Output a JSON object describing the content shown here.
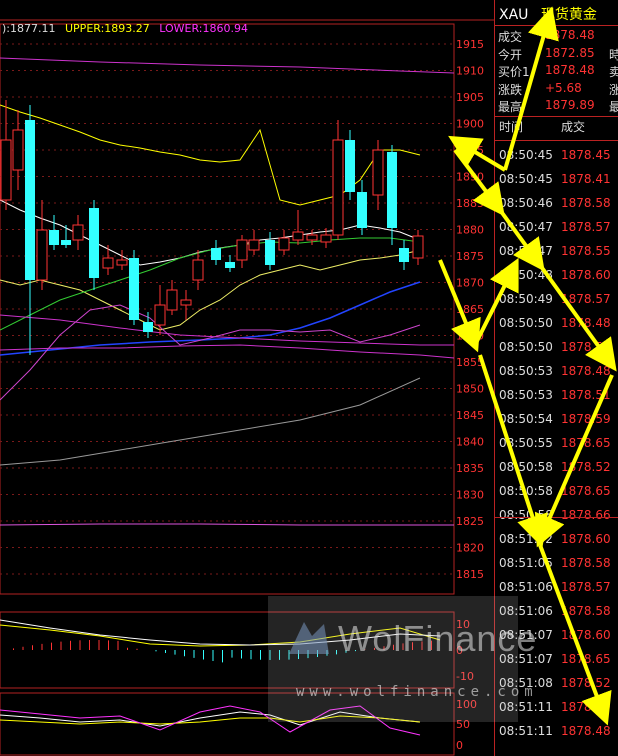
{
  "legend": {
    "mid": "):1877.11",
    "upper": "UPPER:1893.27",
    "lower": "LOWER:1860.94",
    "colors": {
      "mid": "#dddddd",
      "upper": "#ffff00",
      "lower": "#ff33ff"
    }
  },
  "price_axis": [
    "1915",
    "1910",
    "1905",
    "1900",
    "1895",
    "1890",
    "1885",
    "1880",
    "1875",
    "1870",
    "1865",
    "1860",
    "1855",
    "1850",
    "1845",
    "1840",
    "1835",
    "1830",
    "1825",
    "1820",
    "1815"
  ],
  "macd_axis": [
    "10",
    "0",
    "-10"
  ],
  "kdj_axis": [
    "100",
    "50",
    "0"
  ],
  "side_panel": {
    "symbol": "XAU",
    "name": "现货黄金",
    "quote": [
      {
        "label": "成交",
        "value": "1878.48",
        "tail": ""
      },
      {
        "label": "今开",
        "value": "1872.85",
        "tail": "時"
      },
      {
        "label": "买价1",
        "value": "1878.48",
        "tail": "卖"
      },
      {
        "label": "涨跌",
        "value": "+5.68",
        "tail": "涨"
      },
      {
        "label": "最高",
        "value": "1879.89",
        "tail": "最"
      }
    ],
    "trade_header": {
      "time": "时间",
      "price": "成交"
    },
    "trades": [
      {
        "time": "08:50:45",
        "price": "1878.45"
      },
      {
        "time": "08:50:45",
        "price": "1878.41"
      },
      {
        "time": "08:50:46",
        "price": "1878.58"
      },
      {
        "time": "08:50:47",
        "price": "1878.57"
      },
      {
        "time": "08:50:47",
        "price": "1878.55"
      },
      {
        "time": "08:50:48",
        "price": "1878.60"
      },
      {
        "time": "08:50:49",
        "price": "1878.57"
      },
      {
        "time": "08:50:50",
        "price": "1878.48"
      },
      {
        "time": "08:50:50",
        "price": "1878.55"
      },
      {
        "time": "08:50:53",
        "price": "1878.48"
      },
      {
        "time": "08:50:53",
        "price": "1878.51"
      },
      {
        "time": "08:50:54",
        "price": "1878.59"
      },
      {
        "time": "08:50:55",
        "price": "1878.65"
      },
      {
        "time": "08:50:58",
        "price": "1878.52"
      },
      {
        "time": "08:50:58",
        "price": "1878.65"
      },
      {
        "time": "08:50:58",
        "price": "1878.66"
      },
      {
        "time": "08:51:02",
        "price": "1878.60"
      },
      {
        "time": "08:51:05",
        "price": "1878.58"
      },
      {
        "time": "08:51:06",
        "price": "1878.57"
      },
      {
        "time": "08:51:06",
        "price": "1878.58"
      },
      {
        "time": "08:51:07",
        "price": "1878.60"
      },
      {
        "time": "08:51:07",
        "price": "1878.65"
      },
      {
        "time": "08:51:08",
        "price": "1878.52"
      },
      {
        "time": "08:51:11",
        "price": "1878.59"
      },
      {
        "time": "08:51:11",
        "price": "1878.48"
      }
    ]
  },
  "watermark": {
    "brand": "WolFinance",
    "url": "www.wolfinance.com"
  },
  "colors": {
    "up": "#ff3333",
    "down": "#33ffff",
    "grid": "#b22222",
    "arrow": "#ffff00"
  }
}
